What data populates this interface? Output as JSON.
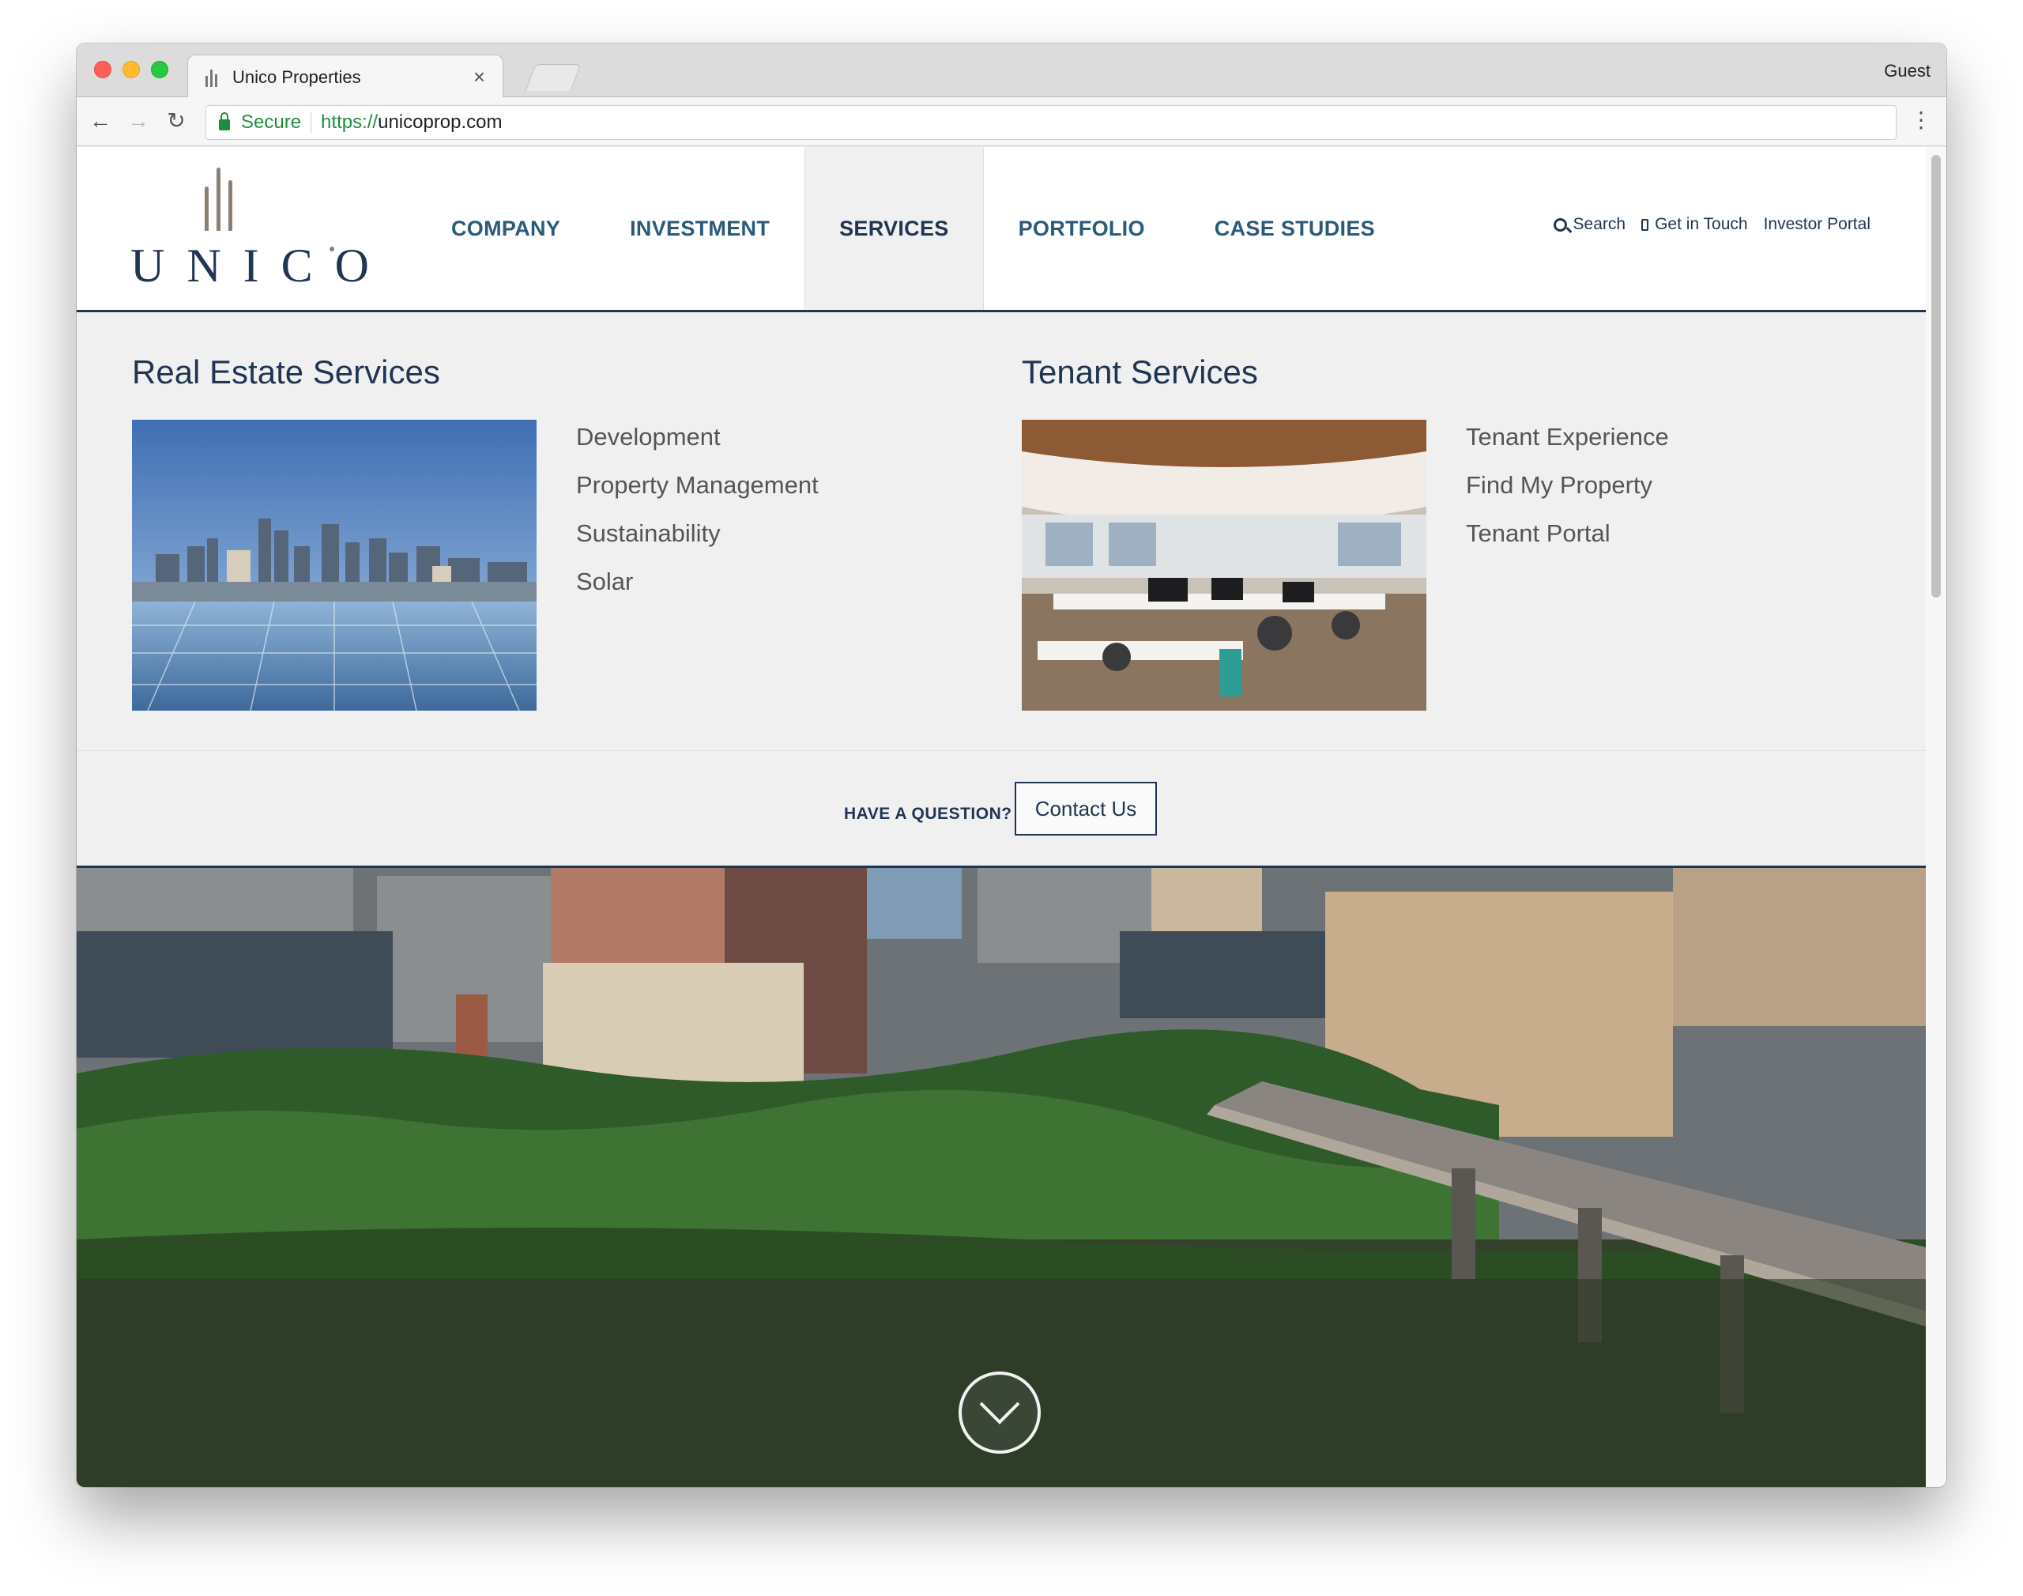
{
  "browser": {
    "tab_title": "Unico Properties",
    "tab_close": "×",
    "profile": "Guest",
    "secure_label": "Secure",
    "url_scheme": "https://",
    "url_host": "unicoprop.com",
    "back": "←",
    "forward": "→",
    "reload": "↻",
    "menu": "⋮"
  },
  "site": {
    "logo_text": "UNICO",
    "nav": [
      "COMPANY",
      "INVESTMENT",
      "SERVICES",
      "PORTFOLIO",
      "CASE STUDIES"
    ],
    "active_nav": "SERVICES",
    "utility": {
      "search": "Search",
      "get_in_touch": "Get in Touch",
      "investor_portal": "Investor Portal"
    },
    "colors": {
      "navy": "#1f3552",
      "nav_text": "#2a5a7a",
      "logo_bars": "#8b7f74"
    }
  },
  "mega_menu": {
    "real_estate": {
      "heading": "Real Estate Services",
      "links": [
        "Development",
        "Property Management",
        "Sustainability",
        "Solar"
      ]
    },
    "tenant": {
      "heading": "Tenant Services",
      "links": [
        "Tenant Experience",
        "Find My Property",
        "Tenant Portal"
      ]
    }
  },
  "cta": {
    "question": "HAVE A QUESTION?",
    "button": "Contact Us"
  }
}
